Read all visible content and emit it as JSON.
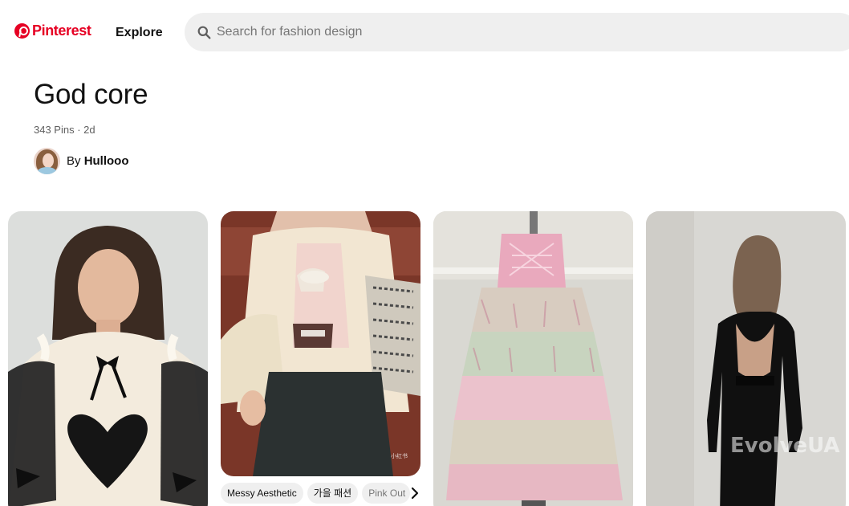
{
  "header": {
    "logo_text": "Pinterest",
    "explore_label": "Explore",
    "search_placeholder": "Search for fashion design"
  },
  "board": {
    "title": "God core",
    "meta": "343 Pins · 2d",
    "owner_prefix": "By",
    "owner_name": "Hullooo"
  },
  "pins": [
    {
      "icon": "pin-image-lace-blouse"
    },
    {
      "icon": "pin-image-cream-cardigan",
      "tags": [
        "Messy Aesthetic",
        "가을 패션",
        "Pink Out"
      ]
    },
    {
      "icon": "pin-image-tiered-skirt"
    },
    {
      "icon": "pin-image-black-dress",
      "watermark": "EvolveUA"
    }
  ],
  "colors": {
    "brand": "#e60023",
    "search_bg": "#efefef",
    "tag_bg": "#efefef"
  }
}
